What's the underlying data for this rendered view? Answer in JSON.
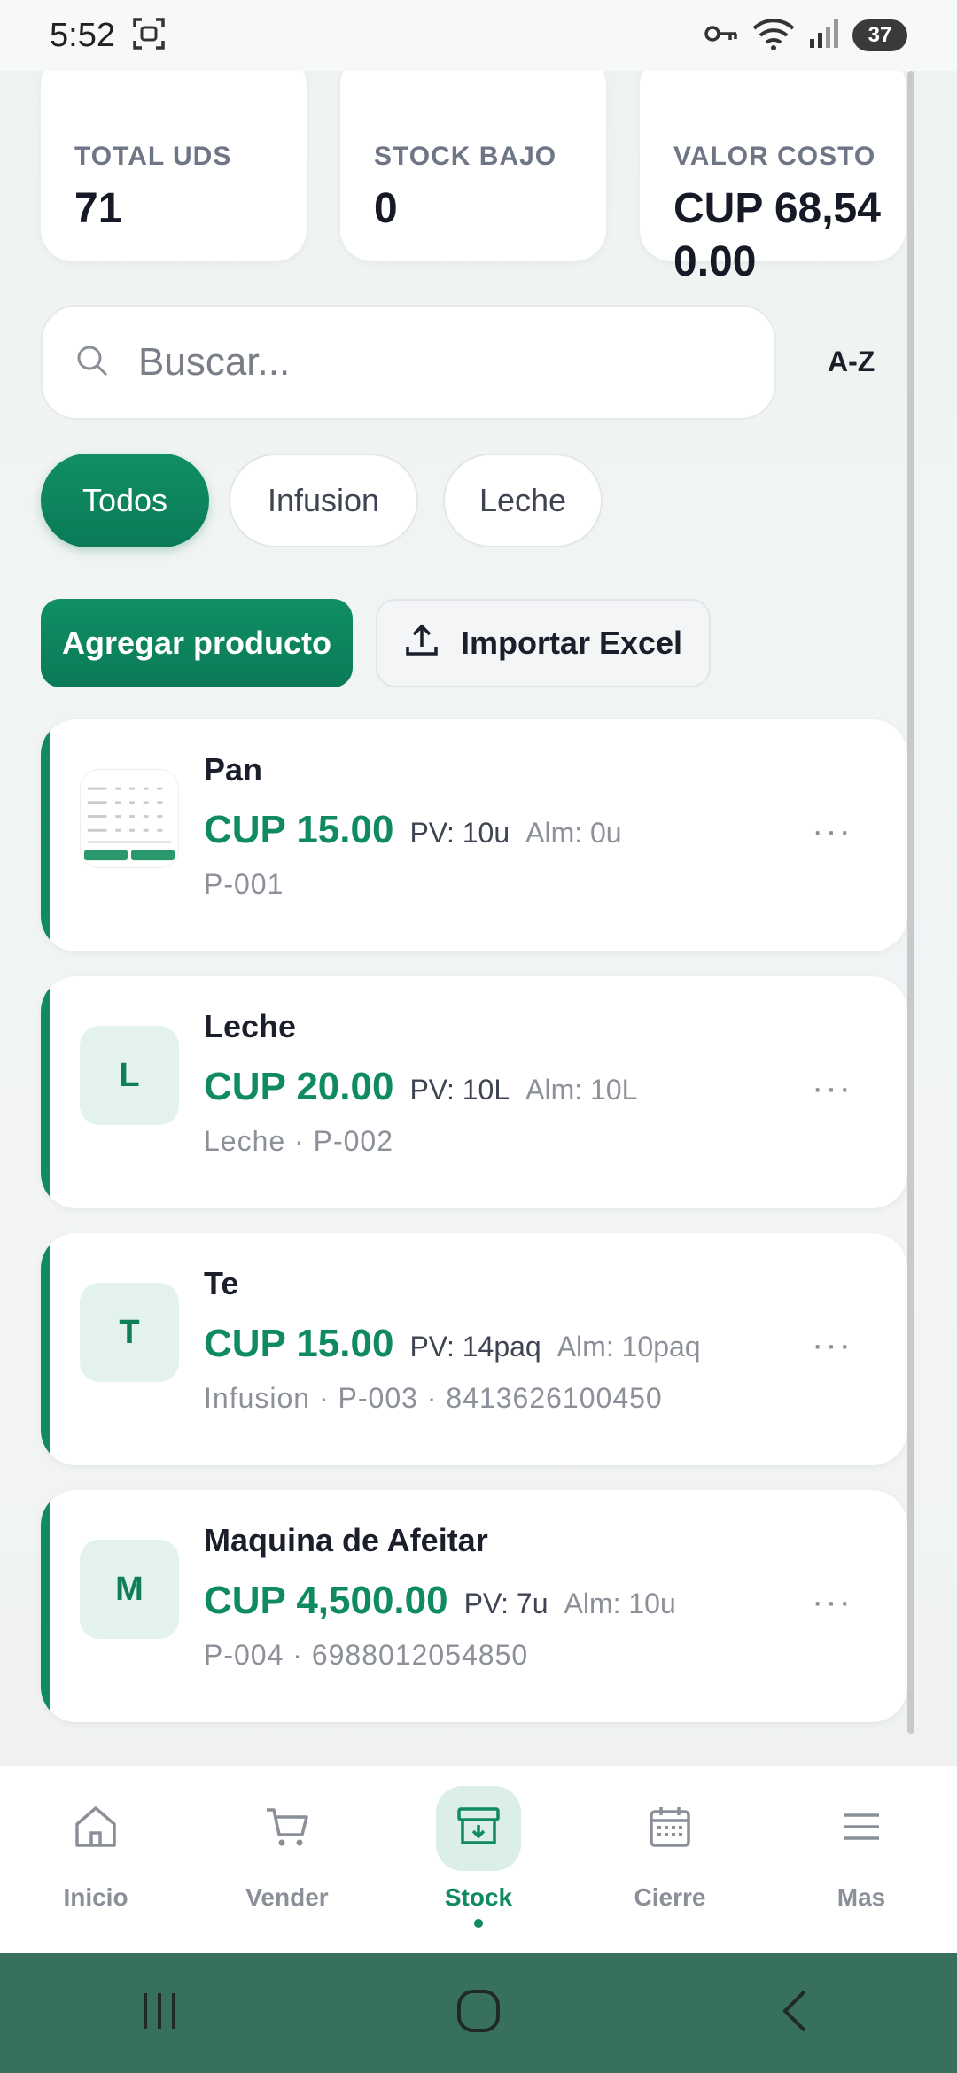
{
  "status_bar": {
    "time": "5:52",
    "battery": "37"
  },
  "stats": [
    {
      "label": "TOTAL UDS",
      "value": "71"
    },
    {
      "label": "STOCK BAJO",
      "value": "0"
    },
    {
      "label": "VALOR COSTO",
      "value": "CUP 68,540.00"
    }
  ],
  "search": {
    "placeholder": "Buscar...",
    "value": ""
  },
  "sort_label": "A-Z",
  "filters": [
    "Todos",
    "Infusion",
    "Leche"
  ],
  "active_filter": "Todos",
  "actions": {
    "add_label": "Agregar producto",
    "import_label": "Importar Excel"
  },
  "products": [
    {
      "name": "Pan",
      "price": "CUP 15.00",
      "pv": "PV: 10u",
      "alm": "Alm: 0u",
      "meta": "P-001",
      "initial": ""
    },
    {
      "name": "Leche",
      "price": "CUP 20.00",
      "pv": "PV: 10L",
      "alm": "Alm: 10L",
      "meta": "Leche · P-002",
      "initial": "L"
    },
    {
      "name": "Te",
      "price": "CUP 15.00",
      "pv": "PV: 14paq",
      "alm": "Alm: 10paq",
      "meta": "Infusion · P-003 · 8413626100450",
      "initial": "T"
    },
    {
      "name": "Maquina de Afeitar",
      "price": "CUP 4,500.00",
      "pv": "PV: 7u",
      "alm": "Alm: 10u",
      "meta": "P-004 · 6988012054850",
      "initial": "M"
    }
  ],
  "more_glyph": "···",
  "nav": [
    {
      "label": "Inicio",
      "icon": "home-icon"
    },
    {
      "label": "Vender",
      "icon": "cart-icon"
    },
    {
      "label": "Stock",
      "icon": "archive-icon"
    },
    {
      "label": "Cierre",
      "icon": "calendar-icon"
    },
    {
      "label": "Mas",
      "icon": "menu-icon"
    }
  ],
  "active_nav": "Stock",
  "colors": {
    "accent": "#0f8a62",
    "accent_soft": "#dcefe7",
    "system_nav": "#37705f"
  }
}
